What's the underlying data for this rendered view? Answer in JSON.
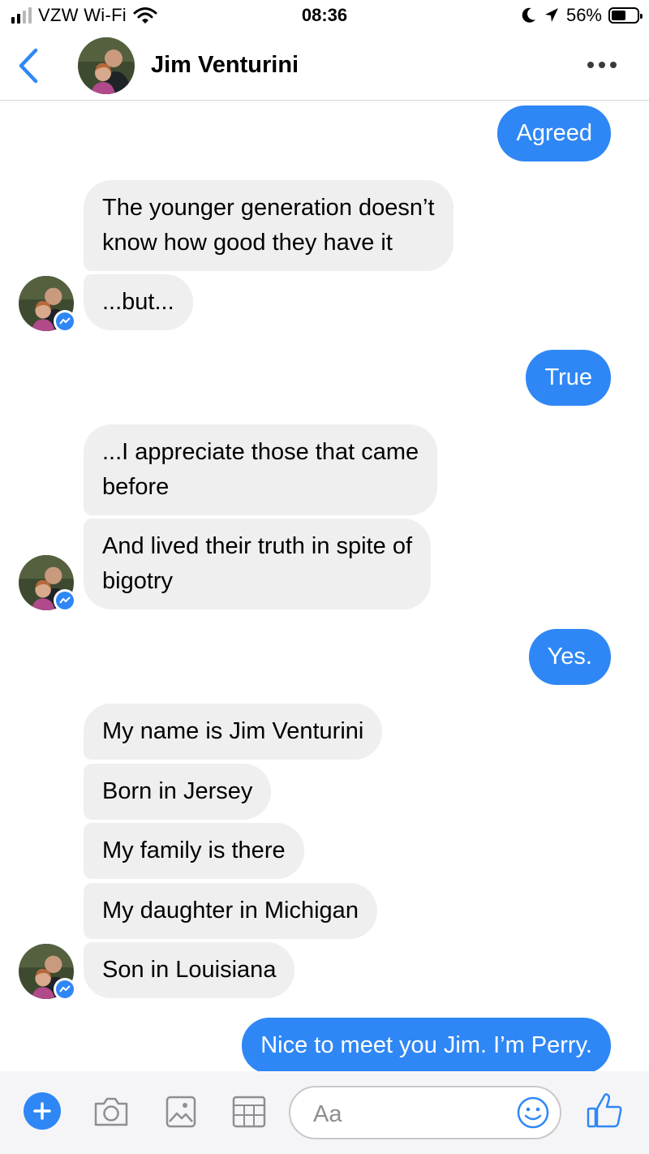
{
  "status_bar": {
    "carrier": "VZW Wi-Fi",
    "time": "08:36",
    "battery_percent": "56%",
    "battery_level": 0.56,
    "signal_bars": 4,
    "signal_bars_lit": 2,
    "icons": [
      "cellular-signal-icon",
      "wifi-icon",
      "moon-icon",
      "location-arrow-icon",
      "battery-icon"
    ]
  },
  "header": {
    "back_icon": "chevron-left-icon",
    "contact_name": "Jim Venturini",
    "more_icon": "more-horizontal-icon"
  },
  "messages": [
    {
      "direction": "out",
      "text": "Agreed"
    },
    {
      "direction": "in",
      "lines": [
        "The younger generation doesn’t",
        "know how good they have it"
      ]
    },
    {
      "direction": "in",
      "text": "...but...",
      "avatar": true
    },
    {
      "direction": "out",
      "text": "True"
    },
    {
      "direction": "in",
      "lines": [
        "...I appreciate those that came",
        "before"
      ]
    },
    {
      "direction": "in",
      "lines": [
        "And lived their truth in spite of",
        "bigotry"
      ],
      "avatar": true
    },
    {
      "direction": "out",
      "text": "Yes."
    },
    {
      "direction": "in",
      "text": "My name is Jim Venturini"
    },
    {
      "direction": "in",
      "text": "Born in Jersey"
    },
    {
      "direction": "in",
      "text": "My family is there"
    },
    {
      "direction": "in",
      "text": "My daughter in Michigan"
    },
    {
      "direction": "in",
      "text": "Son in Louisiana",
      "avatar": true
    },
    {
      "direction": "out",
      "text": "Nice to meet you Jim. I’m Perry."
    }
  ],
  "composer": {
    "placeholder": "Aa",
    "icons": [
      "plus-icon",
      "camera-icon",
      "image-icon",
      "calendar-icon",
      "emoji-icon",
      "thumbs-up-icon"
    ]
  },
  "colors": {
    "outgoing_bubble": "#2f87f5",
    "incoming_bubble": "#efefef",
    "accent": "#2f87f5"
  }
}
